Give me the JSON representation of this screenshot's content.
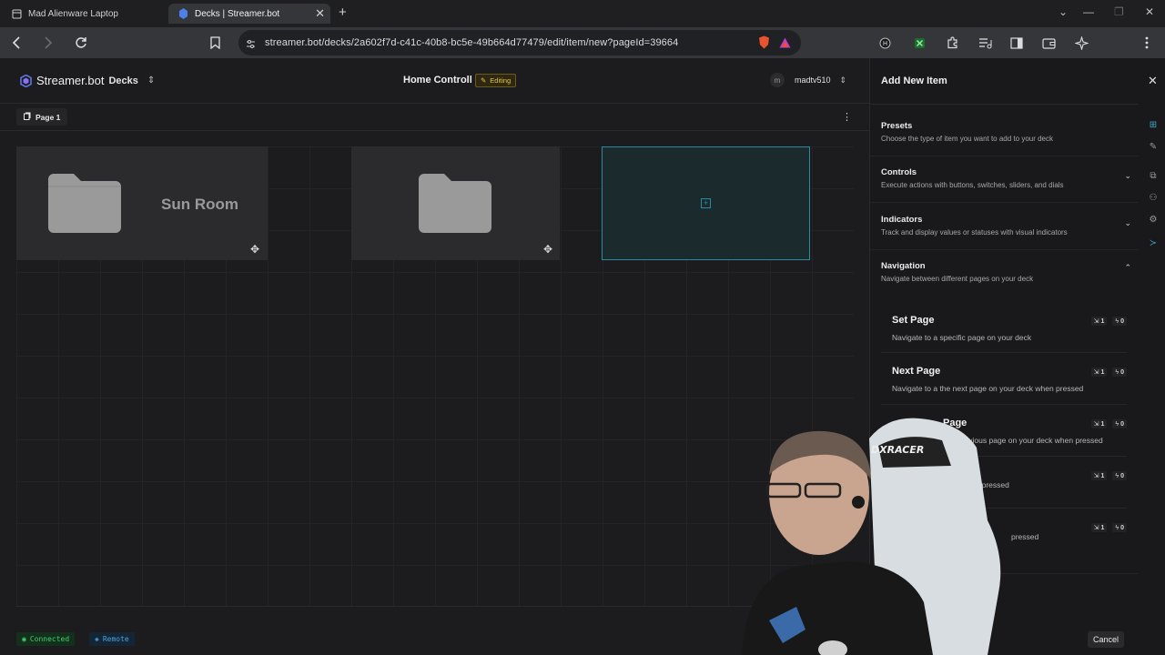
{
  "browser": {
    "tabs": [
      {
        "title": "Mad Alienware Laptop",
        "active": false
      },
      {
        "title": "Decks | Streamer.bot",
        "active": true
      }
    ],
    "url": "streamer.bot/decks/2a602f7d-c41c-40b8-bc5e-49b664d77479/edit/item/new?pageId=39664"
  },
  "app": {
    "brand": "Streamer.bot",
    "section": "Decks",
    "deck_title": "Home Controll",
    "editing_label": "Editing",
    "user_initial": "m",
    "user_name": "madtv510",
    "page_label": "Page 1",
    "tiles": [
      {
        "label": "Sun Room"
      },
      {
        "label": ""
      }
    ],
    "status": {
      "connected": "Connected",
      "remote": "Remote"
    }
  },
  "panel": {
    "title": "Add New Item",
    "presets": {
      "title": "Presets",
      "desc": "Choose the type of item you want to add to your deck"
    },
    "sections": [
      {
        "title": "Controls",
        "desc": "Execute actions with buttons, switches, sliders, and dials"
      },
      {
        "title": "Indicators",
        "desc": "Track and display values or statuses with visual indicators"
      },
      {
        "title": "Navigation",
        "desc": "Navigate between different pages on your deck"
      }
    ],
    "items": [
      {
        "title": "Set Page",
        "desc": "Navigate to a specific page on your deck",
        "a": "1",
        "b": "0"
      },
      {
        "title": "Next Page",
        "desc": "Navigate to a the next page on your deck when pressed",
        "a": "1",
        "b": "0"
      },
      {
        "title": "Page",
        "desc": "previous page on your deck when pressed",
        "a": "1",
        "b": "0"
      },
      {
        "title": "",
        "desc": "folder deck when pressed",
        "a": "1",
        "b": "0"
      },
      {
        "title": "",
        "desc": "pressed",
        "a": "1",
        "b": "0"
      }
    ],
    "cancel_label": "Cancel"
  },
  "colors": {
    "accent": "#2a8aa0",
    "editing": "#e3c54a",
    "connected": "#3ecf6a",
    "remote": "#4aa3df"
  }
}
